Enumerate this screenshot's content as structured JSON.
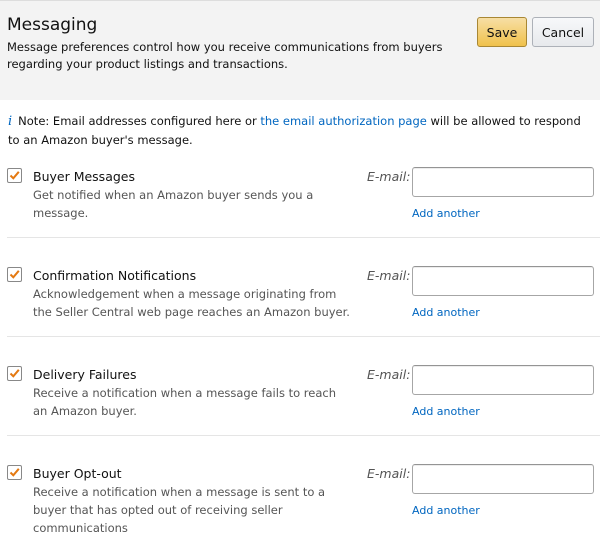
{
  "header": {
    "title": "Messaging",
    "description": "Message preferences control how you receive communications from buyers regarding your product listings and transactions.",
    "save_label": "Save",
    "cancel_label": "Cancel"
  },
  "note": {
    "icon": "info-icon",
    "prefix": "Note: Email addresses configured here or ",
    "link_text": "the email authorization page",
    "suffix": " will be allowed to respond to an Amazon buyer's message."
  },
  "options": [
    {
      "label": "Buyer Messages",
      "description": "Get notified when an Amazon buyer sends you a message.",
      "checked": true,
      "email_label": "E-mail:",
      "email_value": "",
      "add_another": "Add another"
    },
    {
      "label": "Confirmation Notifications",
      "description": "Acknowledgement when a message originating from the Seller Central web page reaches an Amazon buyer.",
      "checked": true,
      "email_label": "E-mail:",
      "email_value": "",
      "add_another": "Add another"
    },
    {
      "label": "Delivery Failures",
      "description": "Receive a notification when a message fails to reach an Amazon buyer.",
      "checked": true,
      "email_label": "E-mail:",
      "email_value": "",
      "add_another": "Add another"
    },
    {
      "label": "Buyer Opt-out",
      "description": "Receive a notification when a message is sent to a buyer that has opted out of receiving seller communications",
      "checked": true,
      "email_label": "E-mail:",
      "email_value": "",
      "add_another": "Add another"
    }
  ],
  "colors": {
    "checkmark": "#e47911",
    "link": "#0066c0",
    "save_button": "#f0c14b"
  }
}
